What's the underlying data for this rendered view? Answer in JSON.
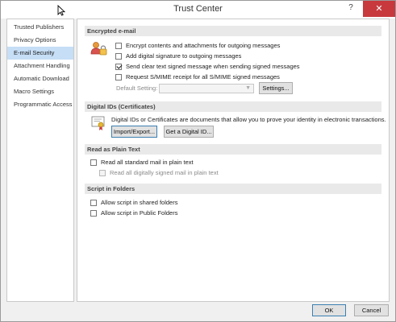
{
  "window": {
    "title": "Trust Center",
    "help_label": "?",
    "close_label": "✕"
  },
  "sidebar": {
    "items": [
      {
        "label": "Trusted Publishers"
      },
      {
        "label": "Privacy Options"
      },
      {
        "label": "E-mail Security"
      },
      {
        "label": "Attachment Handling"
      },
      {
        "label": "Automatic Download"
      },
      {
        "label": "Macro Settings"
      },
      {
        "label": "Programmatic Access"
      }
    ],
    "selected": "E-mail Security"
  },
  "encrypted": {
    "heading": "Encrypted e-mail",
    "opt_encrypt": "Encrypt contents and attachments for outgoing messages",
    "opt_signature": "Add digital signature to outgoing messages",
    "opt_cleartext": "Send clear text signed message when sending signed messages",
    "opt_receipt": "Request S/MIME receipt for all S/MIME signed messages",
    "default_setting_label": "Default Setting:",
    "settings_button": "Settings..."
  },
  "digital_ids": {
    "heading": "Digital IDs (Certificates)",
    "description": "Digital IDs or Certificates are documents that allow you to prove your identity in electronic transactions.",
    "import_button": "Import/Export...",
    "get_button": "Get a Digital ID..."
  },
  "plain_text": {
    "heading": "Read as Plain Text",
    "opt_standard": "Read all standard mail in plain text",
    "opt_signed": "Read all digitally signed mail in plain text"
  },
  "script": {
    "heading": "Script in Folders",
    "opt_shared": "Allow script in shared folders",
    "opt_public": "Allow script in Public Folders"
  },
  "footer": {
    "ok": "OK",
    "cancel": "Cancel"
  }
}
